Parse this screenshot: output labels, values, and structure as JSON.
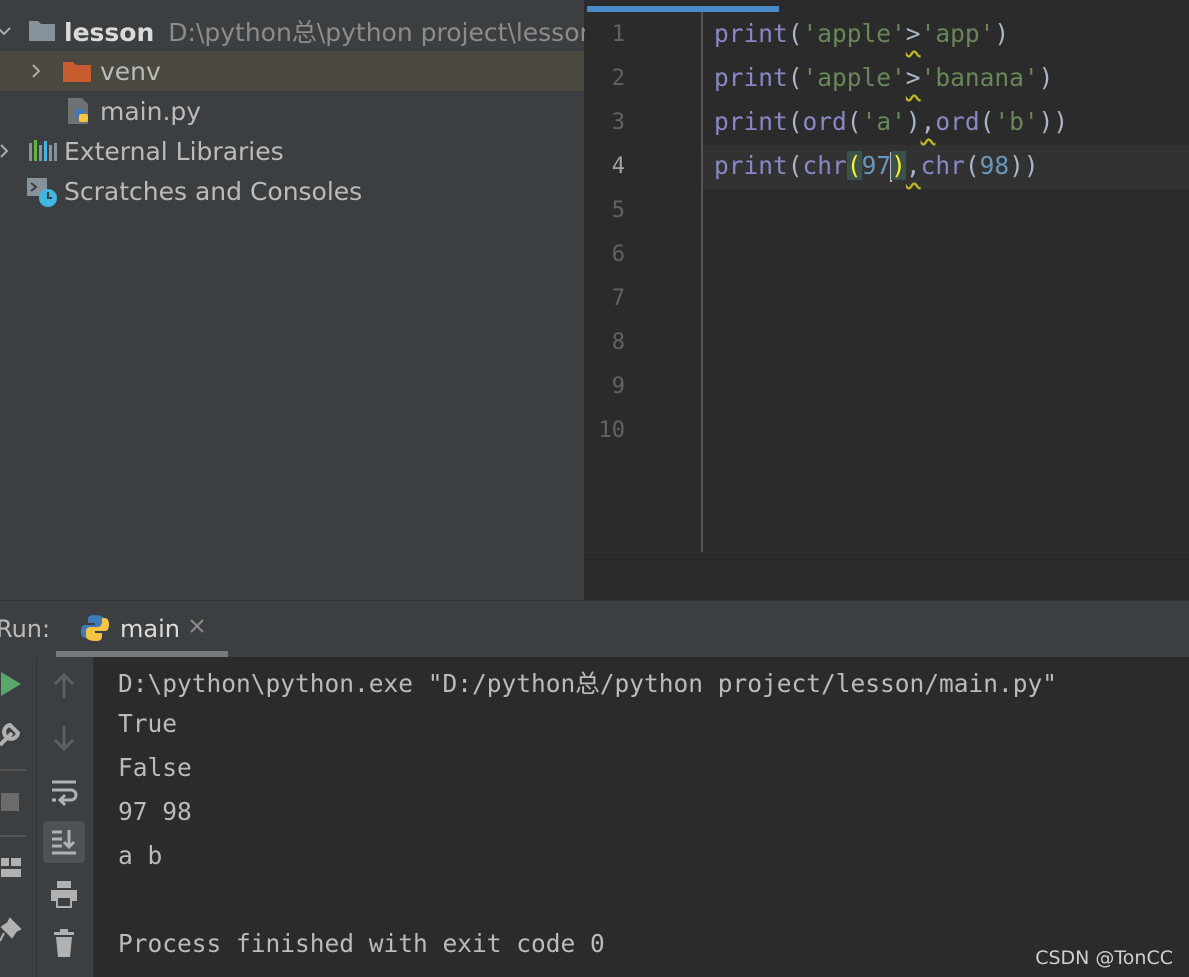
{
  "project": {
    "root_name": "lesson",
    "root_path": "D:\\python总\\python project\\lesson",
    "items": [
      {
        "label": "venv",
        "icon": "folder-icon"
      },
      {
        "label": "main.py",
        "icon": "python-file-icon"
      },
      {
        "label": "External Libraries",
        "icon": "libraries-icon"
      },
      {
        "label": "Scratches and Consoles",
        "icon": "scratches-icon"
      }
    ]
  },
  "editor": {
    "line_numbers": [
      "1",
      "2",
      "3",
      "4",
      "5",
      "6",
      "7",
      "8",
      "9",
      "10"
    ],
    "current_line": 4,
    "code": [
      "print('apple'>'app')",
      "print('apple'>'banana')",
      "print(ord('a'),ord('b'))",
      "print(chr(97),chr(98))"
    ]
  },
  "run": {
    "label": "Run:",
    "tab_label": "main",
    "console": [
      "D:\\python\\python.exe \"D:/python总/python project/lesson/main.py\"",
      "True",
      "False",
      "97 98",
      "a b",
      "",
      "Process finished with exit code 0"
    ]
  },
  "watermark": "CSDN @TonCC",
  "colors": {
    "accent": "#4a88c7",
    "folder_orange": "#c75c2e",
    "run_green": "#59a869",
    "keyword": "#8888c6",
    "string": "#6a8759",
    "number": "#6897bb"
  }
}
